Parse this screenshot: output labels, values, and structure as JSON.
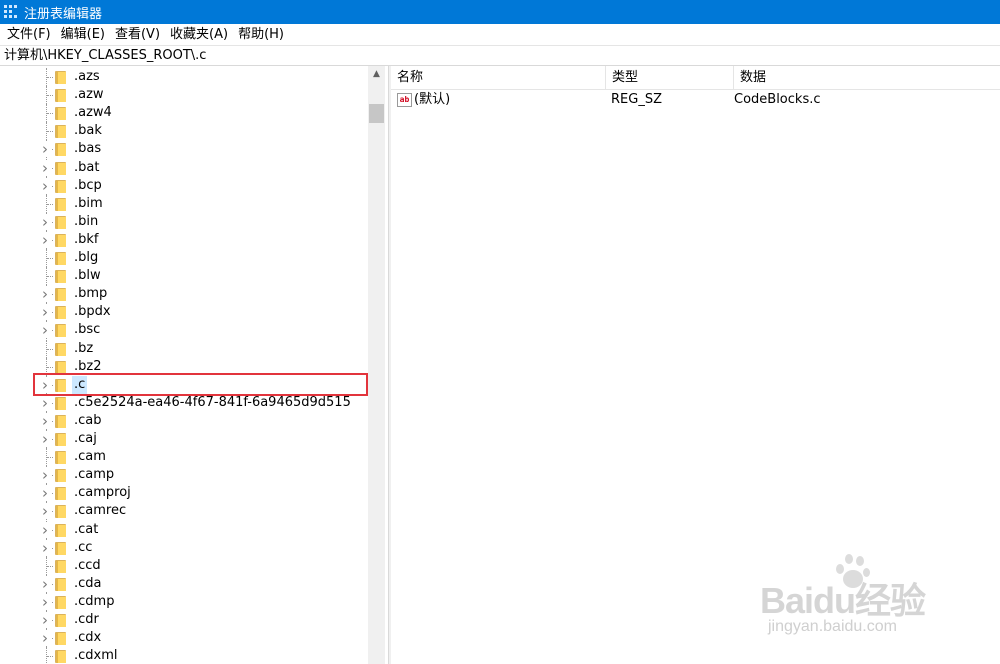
{
  "window": {
    "title": "注册表编辑器"
  },
  "menu": [
    {
      "label": "文件(F)"
    },
    {
      "label": "编辑(E)"
    },
    {
      "label": "查看(V)"
    },
    {
      "label": "收藏夹(A)"
    },
    {
      "label": "帮助(H)"
    }
  ],
  "address": {
    "path": "计算机\\HKEY_CLASSES_ROOT\\.c"
  },
  "tree": {
    "items": [
      {
        "label": ".azs",
        "expandable": false
      },
      {
        "label": ".azw",
        "expandable": false
      },
      {
        "label": ".azw4",
        "expandable": false
      },
      {
        "label": ".bak",
        "expandable": false
      },
      {
        "label": ".bas",
        "expandable": true
      },
      {
        "label": ".bat",
        "expandable": true
      },
      {
        "label": ".bcp",
        "expandable": true
      },
      {
        "label": ".bim",
        "expandable": false
      },
      {
        "label": ".bin",
        "expandable": true
      },
      {
        "label": ".bkf",
        "expandable": true
      },
      {
        "label": ".blg",
        "expandable": false
      },
      {
        "label": ".blw",
        "expandable": false
      },
      {
        "label": ".bmp",
        "expandable": true
      },
      {
        "label": ".bpdx",
        "expandable": true
      },
      {
        "label": ".bsc",
        "expandable": true
      },
      {
        "label": ".bz",
        "expandable": false
      },
      {
        "label": ".bz2",
        "expandable": false
      },
      {
        "label": ".c",
        "expandable": true,
        "selected": true
      },
      {
        "label": ".c5e2524a-ea46-4f67-841f-6a9465d9d515",
        "expandable": true
      },
      {
        "label": ".cab",
        "expandable": true
      },
      {
        "label": ".caj",
        "expandable": true
      },
      {
        "label": ".cam",
        "expandable": false
      },
      {
        "label": ".camp",
        "expandable": true
      },
      {
        "label": ".camproj",
        "expandable": true
      },
      {
        "label": ".camrec",
        "expandable": true
      },
      {
        "label": ".cat",
        "expandable": true
      },
      {
        "label": ".cc",
        "expandable": true
      },
      {
        "label": ".ccd",
        "expandable": false
      },
      {
        "label": ".cda",
        "expandable": true
      },
      {
        "label": ".cdmp",
        "expandable": true
      },
      {
        "label": ".cdr",
        "expandable": true
      },
      {
        "label": ".cdx",
        "expandable": true
      },
      {
        "label": ".cdxml",
        "expandable": false
      }
    ]
  },
  "detail": {
    "columns": {
      "name": "名称",
      "type": "类型",
      "data": "数据"
    },
    "rows": [
      {
        "name": "(默认)",
        "type": "REG_SZ",
        "data": "CodeBlocks.c",
        "icon": "string-value-icon"
      }
    ]
  },
  "icons": {
    "expand": "chevron-right-icon",
    "folder": "folder-icon",
    "scroll_up": "scroll-up-arrow-icon"
  },
  "colors": {
    "titlebar": "#0078d7",
    "selection": "#cce8ff",
    "highlight_box": "#e2343c",
    "folder": "#ffd864"
  },
  "watermark": {
    "brand": "Baidu经验",
    "site": "jingyan.baidu.com"
  }
}
